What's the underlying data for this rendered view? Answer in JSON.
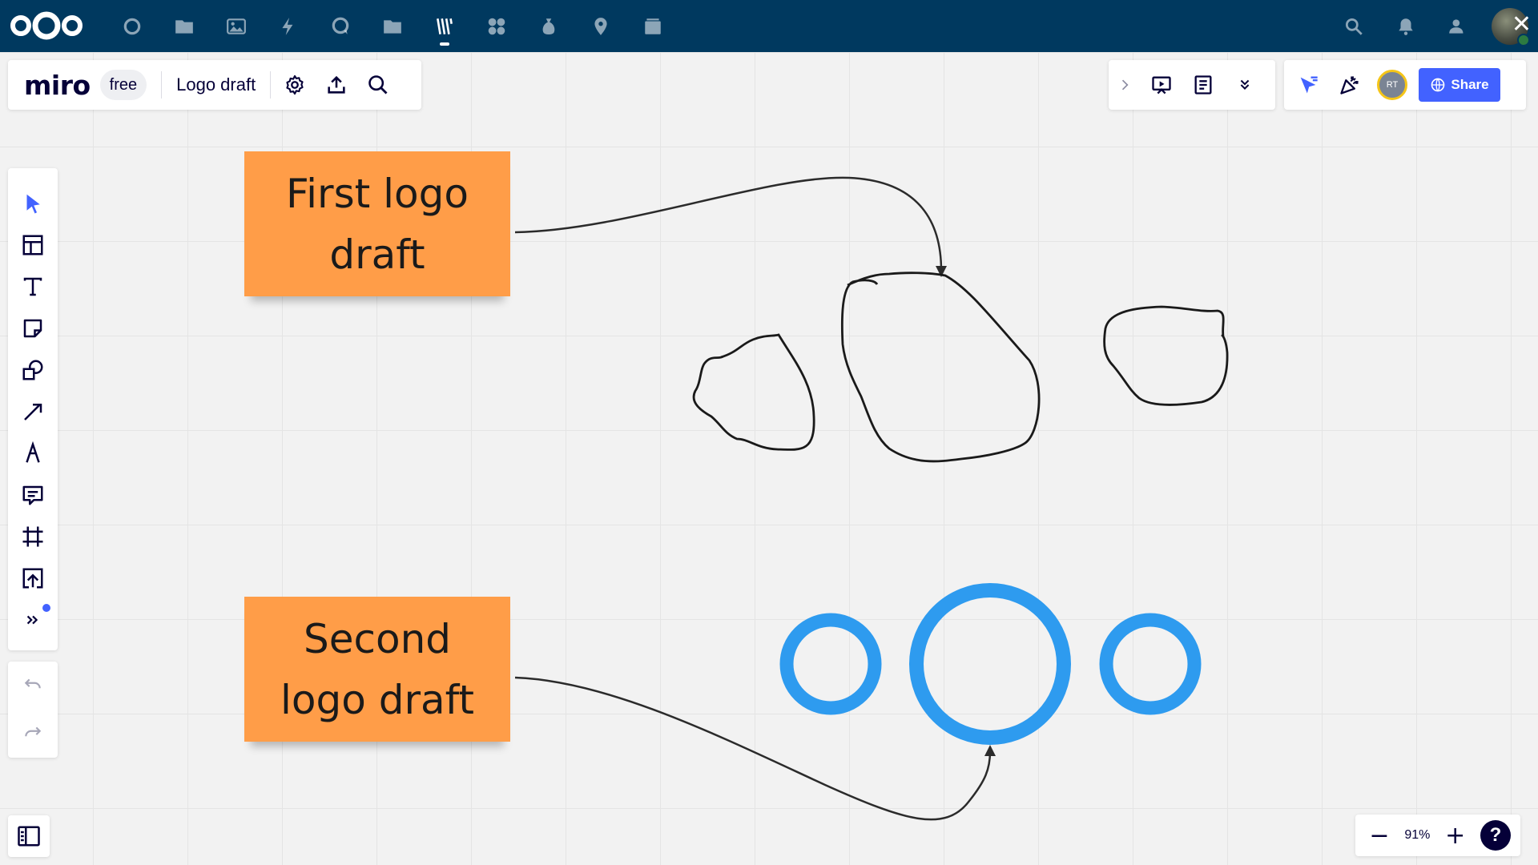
{
  "nextcloud": {
    "apps": [
      "dashboard-icon",
      "files-icon",
      "photos-icon",
      "activity-icon",
      "talk-icon",
      "folder-icon",
      "whiteboard-icon",
      "apps-icon",
      "budget-icon",
      "maps-icon",
      "deck-icon"
    ],
    "active_app": "whiteboard-icon",
    "right_icons": [
      "search-icon",
      "bell-icon",
      "contacts-icon"
    ],
    "close_glyph": "✕"
  },
  "toolbar": {
    "logo": "miro",
    "plan": "free",
    "board_title": "Logo draft"
  },
  "collaboration": {
    "user_initials": "RT",
    "share_label": "Share"
  },
  "canvas": {
    "sticky_1": "First logo draft",
    "sticky_2": "Second logo draft",
    "sticky_color": "#ff9d48",
    "circle_color": "#2e9bef"
  },
  "zoom": {
    "minus": "−",
    "level": "91%",
    "plus": "+",
    "help": "?"
  }
}
